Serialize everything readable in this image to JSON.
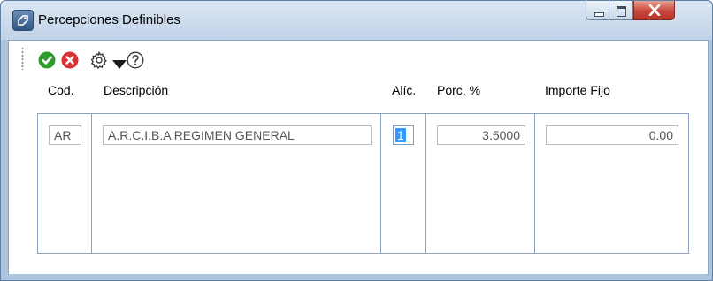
{
  "window": {
    "title": "Percepciones Definibles",
    "icon": "percepciones-icon",
    "controls": {
      "minimize": "minimize-icon",
      "maximize": "maximize-icon",
      "close": "close-icon"
    }
  },
  "toolbar": {
    "accept_icon": "check-circle-icon",
    "cancel_icon": "cancel-circle-icon",
    "settings_icon": "gear-icon",
    "dropdown_icon": "caret-down-icon",
    "help_icon": "help-icon",
    "accept_color": "#2e9b2e",
    "cancel_color": "#d83131"
  },
  "columns": {
    "cod": "Cod.",
    "descripcion": "Descripción",
    "alic": "Alíc.",
    "porc": "Porc. %",
    "importe": "Importe Fijo"
  },
  "rows": [
    {
      "cod": "AR",
      "descripcion": "A.R.C.I.B.A REGIMEN GENERAL",
      "alic": "1",
      "porc": "3.5000",
      "importe": "0.00"
    }
  ]
}
